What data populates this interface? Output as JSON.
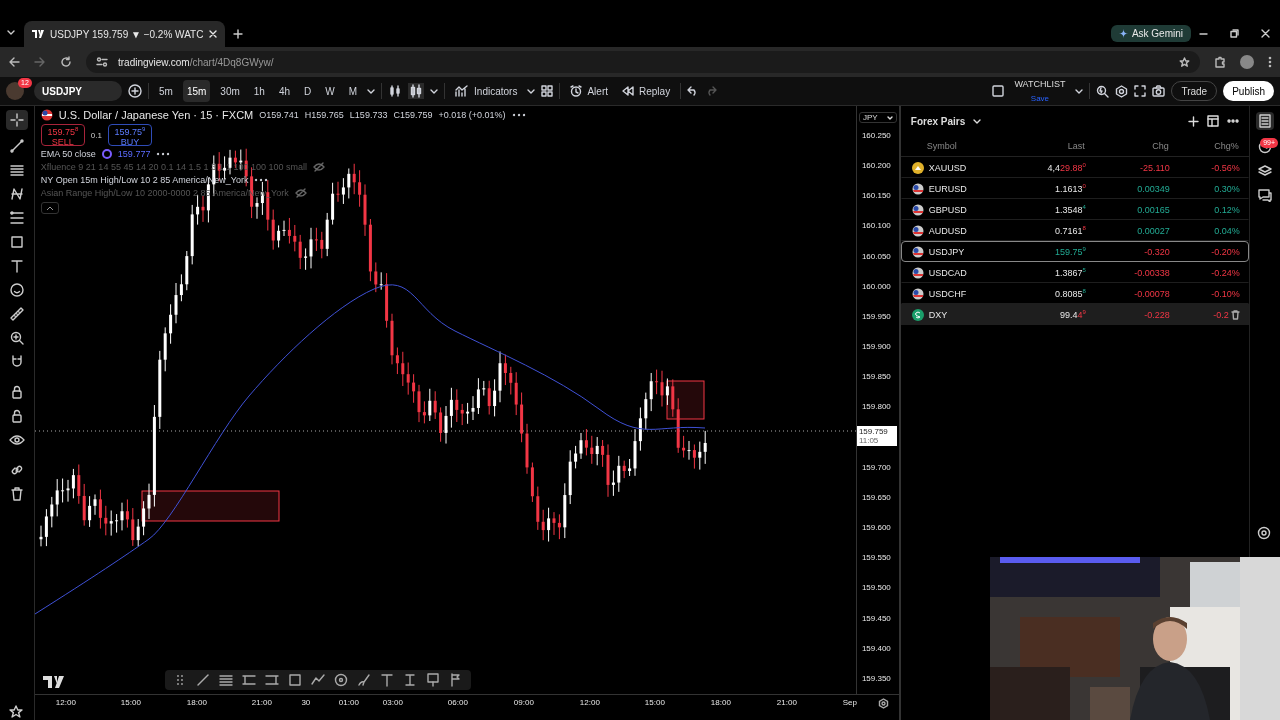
{
  "browser": {
    "tabs": [
      {
        "title": "USDJPY 159.759 ▼ −0.2% WATC",
        "selected": true
      }
    ],
    "ask_gemini": "Ask Gemini",
    "url_host": "tradingview.com",
    "url_path": "/chart/4Dq8GWyw/"
  },
  "toolbar": {
    "avatar_badge": "12",
    "symbol": "USDJPY",
    "intervals": [
      {
        "label": "5m",
        "selected": false
      },
      {
        "label": "15m",
        "selected": true
      },
      {
        "label": "30m",
        "selected": false
      },
      {
        "label": "1h",
        "selected": false
      },
      {
        "label": "4h",
        "selected": false
      },
      {
        "label": "D",
        "selected": false
      },
      {
        "label": "W",
        "selected": false
      },
      {
        "label": "M",
        "selected": false
      }
    ],
    "indicators": "Indicators",
    "alert": "Alert",
    "replay": "Replay",
    "watchlist": "WATCHLIST",
    "watchlist_save": "Save",
    "trade": "Trade",
    "publish": "Publish"
  },
  "chart": {
    "title": "U.S. Dollar / Japanese Yen · 15 · FXCM",
    "ohlc": [
      "O159.741",
      "H159.765",
      "L159.733",
      "C159.759",
      "+0.018 (+0.01%)"
    ],
    "sell": {
      "price": "159.75$^{8}$",
      "label": "SELL"
    },
    "spread": "0.1",
    "buy": {
      "price": "159.75$^{9}$",
      "label": "BUY"
    },
    "studies": [
      {
        "name": "EMA 50 close",
        "value": "159.777",
        "hidden": false
      },
      {
        "name": "Xfluence 9 21 14 55 45 14 20 0.1 14 1.5 1 3 1 1 100 100 100 small",
        "hidden": true
      },
      {
        "name": "NY Open 15m High/Low 10 2 85 America/New_York",
        "hidden": false
      },
      {
        "name": "Asian Range High/Low 10 2000-0000 2 85 America/New_York",
        "hidden": true
      }
    ],
    "currency": "JPY",
    "price_ticks": [
      "160.250",
      "160.200",
      "160.150",
      "160.100",
      "160.050",
      "160.000",
      "159.950",
      "159.900",
      "159.850",
      "159.800",
      "159.700",
      "159.650",
      "159.600",
      "159.550",
      "159.500",
      "159.450",
      "159.400",
      "159.350"
    ],
    "current_price": "159.759",
    "countdown": "11:05",
    "time_ticks": [
      "12:00",
      "15:00",
      "18:00",
      "21:00",
      "30",
      "01:00",
      "03:00",
      "06:00",
      "09:00",
      "12:00",
      "15:00",
      "18:00",
      "21:00",
      "Sep"
    ]
  },
  "watchlist": {
    "title": "Forex Pairs",
    "columns": [
      "Symbol",
      "Last",
      "Chg",
      "Chg%"
    ],
    "rows": [
      {
        "symbol": "XAUUSD",
        "kind": "metal",
        "last_fixed": "4,4",
        "last_moved": "29.88",
        "last_pip": "0",
        "tick_up": false,
        "chg": "-25.110",
        "chg_pct": "-0.56%",
        "change_up": false,
        "selected": false,
        "hovered": false
      },
      {
        "symbol": "EURUSD",
        "kind": "pair",
        "last_fixed": "1.1613",
        "last_pip": "0",
        "tick_up": false,
        "chg": "0.00349",
        "chg_pct": "0.30%",
        "change_up": true,
        "selected": false,
        "hovered": false
      },
      {
        "symbol": "GBPUSD",
        "kind": "pair",
        "last_fixed": "1.3548",
        "last_pip": "4",
        "tick_up": true,
        "chg": "0.00165",
        "chg_pct": "0.12%",
        "change_up": true,
        "selected": false,
        "hovered": false
      },
      {
        "symbol": "AUDUSD",
        "kind": "pair",
        "last_fixed": "0.7161",
        "last_pip": "8",
        "tick_up": false,
        "chg": "0.00027",
        "chg_pct": "0.04%",
        "change_up": true,
        "selected": false,
        "hovered": false
      },
      {
        "symbol": "USDJPY",
        "kind": "pair",
        "last_moved": "159.75",
        "last_pip": "9",
        "tick_up": true,
        "chg": "-0.320",
        "chg_pct": "-0.20%",
        "change_up": false,
        "selected": true,
        "hovered": false
      },
      {
        "symbol": "USDCAD",
        "kind": "pair",
        "last_fixed": "1.3867",
        "last_pip": "5",
        "tick_up": true,
        "chg": "-0.00338",
        "chg_pct": "-0.24%",
        "change_up": false,
        "selected": false,
        "hovered": false
      },
      {
        "symbol": "USDCHF",
        "kind": "pair",
        "last_fixed": "0.8085",
        "last_pip": "8",
        "tick_up": true,
        "chg": "-0.00078",
        "chg_pct": "-0.10%",
        "change_up": false,
        "selected": false,
        "hovered": false
      },
      {
        "symbol": "DXY",
        "kind": "index",
        "last_fixed": "99.4",
        "last_moved": "4",
        "last_pip": "9",
        "tick_up": false,
        "chg": "-0.228",
        "chg_pct": "-0.2",
        "change_up": false,
        "selected": false,
        "hovered": true
      }
    ]
  },
  "rail": {
    "alerts_badge": "99+"
  }
}
